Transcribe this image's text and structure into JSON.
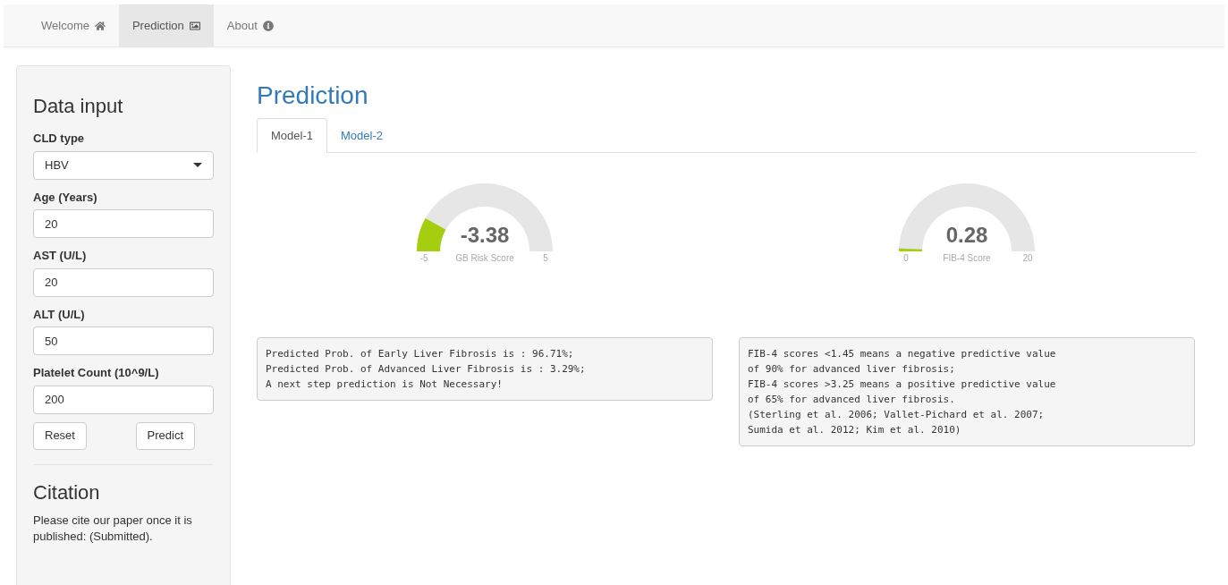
{
  "nav": [
    {
      "label": "Welcome",
      "selected": false
    },
    {
      "label": "Prediction",
      "selected": true
    },
    {
      "label": "About",
      "selected": false
    }
  ],
  "sidebar": {
    "title": "Data input",
    "fields": [
      {
        "kind": "select",
        "label": "CLD type",
        "value": "HBV"
      },
      {
        "kind": "input",
        "label": "Age (Years)",
        "value": "20"
      },
      {
        "kind": "input",
        "label": "AST (U/L)",
        "value": "20"
      },
      {
        "kind": "input",
        "label": "ALT (U/L)",
        "value": "50"
      },
      {
        "kind": "input",
        "label": "Platelet Count (10^9/L)",
        "value": "200"
      }
    ],
    "buttons": [
      "Reset",
      "Predict"
    ],
    "citation": {
      "title": "Citation",
      "text": "Please cite our paper once it is published: (Submitted)."
    }
  },
  "main": {
    "title": "Prediction",
    "tabs": [
      {
        "label": "Model-1",
        "selected": true
      },
      {
        "label": "Model-2",
        "selected": false
      }
    ],
    "panels": [
      {
        "gauge": {
          "value": "-3.38",
          "label": "GB Risk Score",
          "min": "-5",
          "max": "5"
        },
        "output": [
          "Predicted Prob. of Early Liver Fibrosis is : 96.71%;",
          "Predicted Prob. of Advanced Liver Fibrosis is : 3.29%;",
          "A next step prediction is Not Necessary!"
        ]
      },
      {
        "gauge": {
          "value": "0.28",
          "label": "FIB-4 Score",
          "min": "0",
          "max": "20"
        },
        "output": [
          "FIB-4 scores <1.45 means a negative predictive value",
          "of 90% for advanced liver fibrosis;",
          "FIB-4 scores >3.25 means a positive predictive value",
          "of 65% for advanced liver fibrosis.",
          "(Sterling et al. 2006; Vallet-Pichard et al. 2007;",
          "Sumida et al. 2012; Kim et al. 2010)"
        ]
      }
    ]
  }
}
